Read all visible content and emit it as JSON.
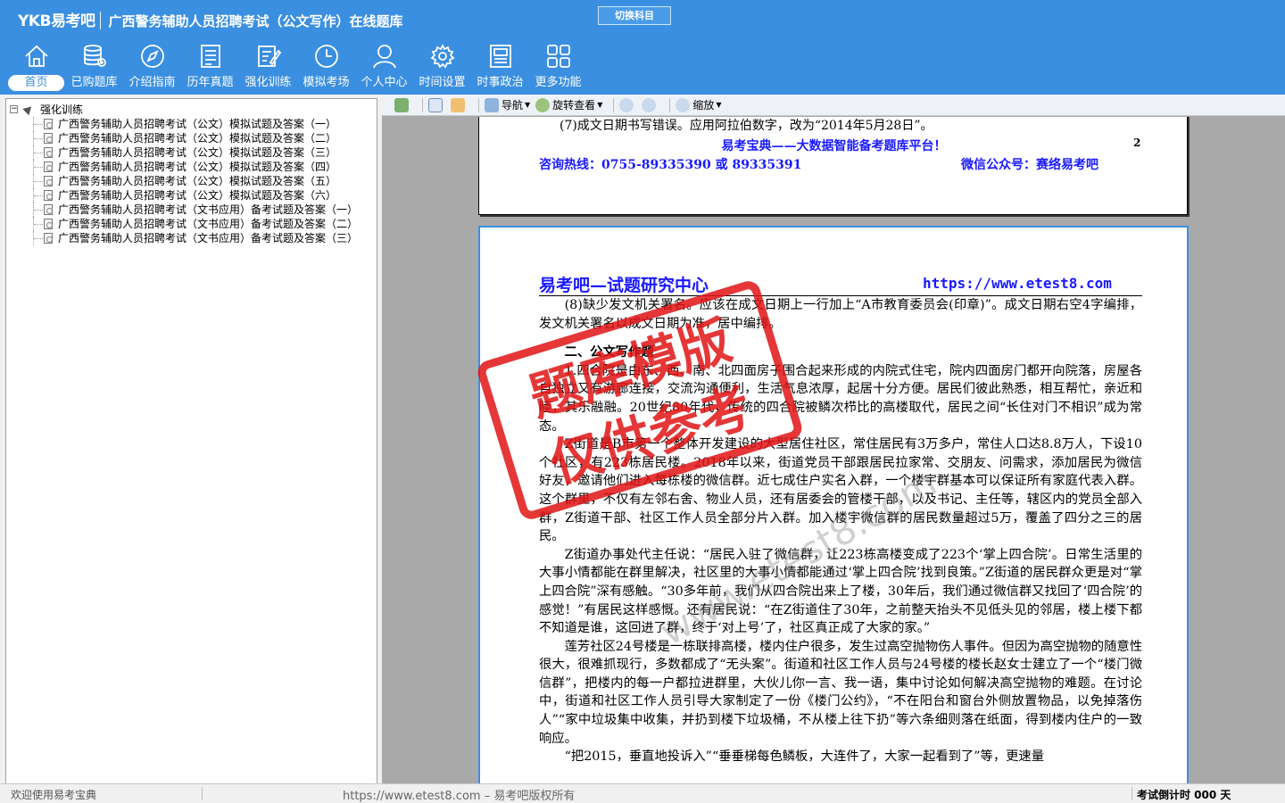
{
  "header": {
    "brand": "YKB易考吧",
    "title": "广西警务辅助人员招聘考试（公文写作）在线题库",
    "switch_label": "切换科目",
    "colors": {
      "bg": "#3b8fe0",
      "text": "#ffffff"
    }
  },
  "nav": [
    {
      "label": "首页",
      "icon": "home-icon"
    },
    {
      "label": "已购题库",
      "icon": "database-icon"
    },
    {
      "label": "介绍指南",
      "icon": "compass-icon"
    },
    {
      "label": "历年真题",
      "icon": "list-doc-icon"
    },
    {
      "label": "强化训练",
      "icon": "edit-doc-icon"
    },
    {
      "label": "模拟考场",
      "icon": "clock-icon"
    },
    {
      "label": "个人中心",
      "icon": "user-icon"
    },
    {
      "label": "时间设置",
      "icon": "gear-icon"
    },
    {
      "label": "时事政治",
      "icon": "news-icon"
    },
    {
      "label": "更多功能",
      "icon": "grid-icon"
    }
  ],
  "tree": {
    "root": "强化训练",
    "items": [
      "广西警务辅助人员招聘考试（公文）模拟试题及答案（一）",
      "广西警务辅助人员招聘考试（公文）模拟试题及答案（二）",
      "广西警务辅助人员招聘考试（公文）模拟试题及答案（三）",
      "广西警务辅助人员招聘考试（公文）模拟试题及答案（四）",
      "广西警务辅助人员招聘考试（公文）模拟试题及答案（五）",
      "广西警务辅助人员招聘考试（公文）模拟试题及答案（六）",
      "广西警务辅助人员招聘考试（文书应用）备考试题及答案（一）",
      "广西警务辅助人员招聘考试（文书应用）备考试题及答案（二）",
      "广西警务辅助人员招聘考试（文书应用）备考试题及答案（三）"
    ]
  },
  "toolbar": {
    "nav_label": "导航",
    "rotate_label": "旋转查看",
    "zoom_label": "缩放"
  },
  "page_prev": {
    "line1": "(7)成文日期书写错误。应用阿拉伯数字，改为“2014年5月28日”。",
    "slogan": "易考宝典——大数据智能备考题库平台！",
    "page_number": "2",
    "hotline": "咨询热线：0755-89335390 或 89335391",
    "wechat": "微信公众号：赛络易考吧"
  },
  "page_cur": {
    "header_left": "易考吧—试题研究中心",
    "header_right": "https://www.etest8.com",
    "p1": "(8)缺少发文机关署名。应该在成文日期上一行加上“A市教育委员会(印章)”。成文日期右空4字编排，发文机关署名以成文日期为准，居中编排。",
    "section": "二、公文写作题",
    "p2": "1.四合院是由东、西、南、北四面房子围合起来形成的内院式住宅，院内四面房门都开向院落，房屋各自独立又有游廊连接，交流沟通便利，生活气息浓厚，起居十分方便。居民们彼此熟悉，相互帮忙，亲近和睦，其乐融融。20世纪80年代，传统的四合院被鳞次栉比的高楼取代，居民之间“长住对门不相识”成为常态。",
    "p3": "Z街道是B市第一个整体开发建设的大型居住社区，常住居民有3万多户，常住人口达8.8万人，下设10个社区，有223栋居民楼。2018年以来，街道党员干部跟居民拉家常、交朋友、问需求，添加居民为微信好友，邀请他们进入每栋楼的微信群。近七成住户实名入群，一个楼宇群基本可以保证所有家庭代表入群。这个群里，不仅有左邻右舍、物业人员，还有居委会的管楼干部，以及书记、主任等，辖区内的党员全部入群，Z街道干部、社区工作人员全部分片入群。加入楼宇微信群的居民数量超过5万，覆盖了四分之三的居民。",
    "p4": "Z街道办事处代主任说：“居民入驻了微信群，让223栋高楼变成了223个‘掌上四合院’。日常生活里的大事小情都能在群里解决，社区里的大事小情都能通过‘掌上四合院’找到良策。”Z街道的居民群众更是对“掌上四合院”深有感触。“30多年前，我们从四合院出来上了楼，30年后，我们通过微信群又找回了‘四合院’的感觉！”有居民这样感慨。还有居民说：“在Z街道住了30年，之前整天抬头不见低头见的邻居，楼上楼下都不知道是谁，这回进了群，终于‘对上号’了，社区真正成了大家的家。”",
    "p5": "莲芳社区24号楼是一栋联排高楼，楼内住户很多，发生过高空抛物伤人事件。但因为高空抛物的随意性很大，很难抓现行，多数都成了“无头案”。街道和社区工作人员与24号楼的楼长赵女士建立了一个“楼门微信群”，把楼内的每一户都拉进群里，大伙儿你一言、我一语，集中讨论如何解决高空抛物的难题。在讨论中，街道和社区工作人员引导大家制定了一份《楼门公约》，“不在阳台和窗台外侧放置物品，以免掉落伤人”“家中垃圾集中收集，并扔到楼下垃圾桶，不从楼上往下扔”等六条细则落在纸面，得到楼内住户的一致响应。",
    "p6": "“把2015，垂直地投诉入”“垂垂梯每色鳞板，大连件了，大家一起看到了”等，更速量",
    "stamp_line1": "题库模版",
    "stamp_line2": "仅供参考",
    "watermark": "www.etest8.com"
  },
  "status": {
    "left": "欢迎使用易考宝典",
    "middle": "https://www.etest8.com – 易考吧版权所有",
    "right": "考试倒计时 000 天"
  }
}
